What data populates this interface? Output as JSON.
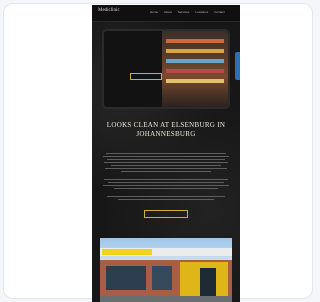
{
  "site": {
    "logo": "Mediclinic",
    "logo_sub": "",
    "nav": [
      "Home",
      "About",
      "Services",
      "Locations",
      "Contact"
    ]
  },
  "hero": {
    "title": "",
    "button": ""
  },
  "main": {
    "heading": "LOOKS CLEAN AT ELSENBURG IN JOHANNESBURG",
    "subheading": "",
    "cta": ""
  },
  "section": {
    "caption": ""
  },
  "colors": {
    "accent_gold": "#c9b03a",
    "accent_blue": "#5c8fd1",
    "side_tab": "#2b6fb5",
    "background": "#171717"
  }
}
